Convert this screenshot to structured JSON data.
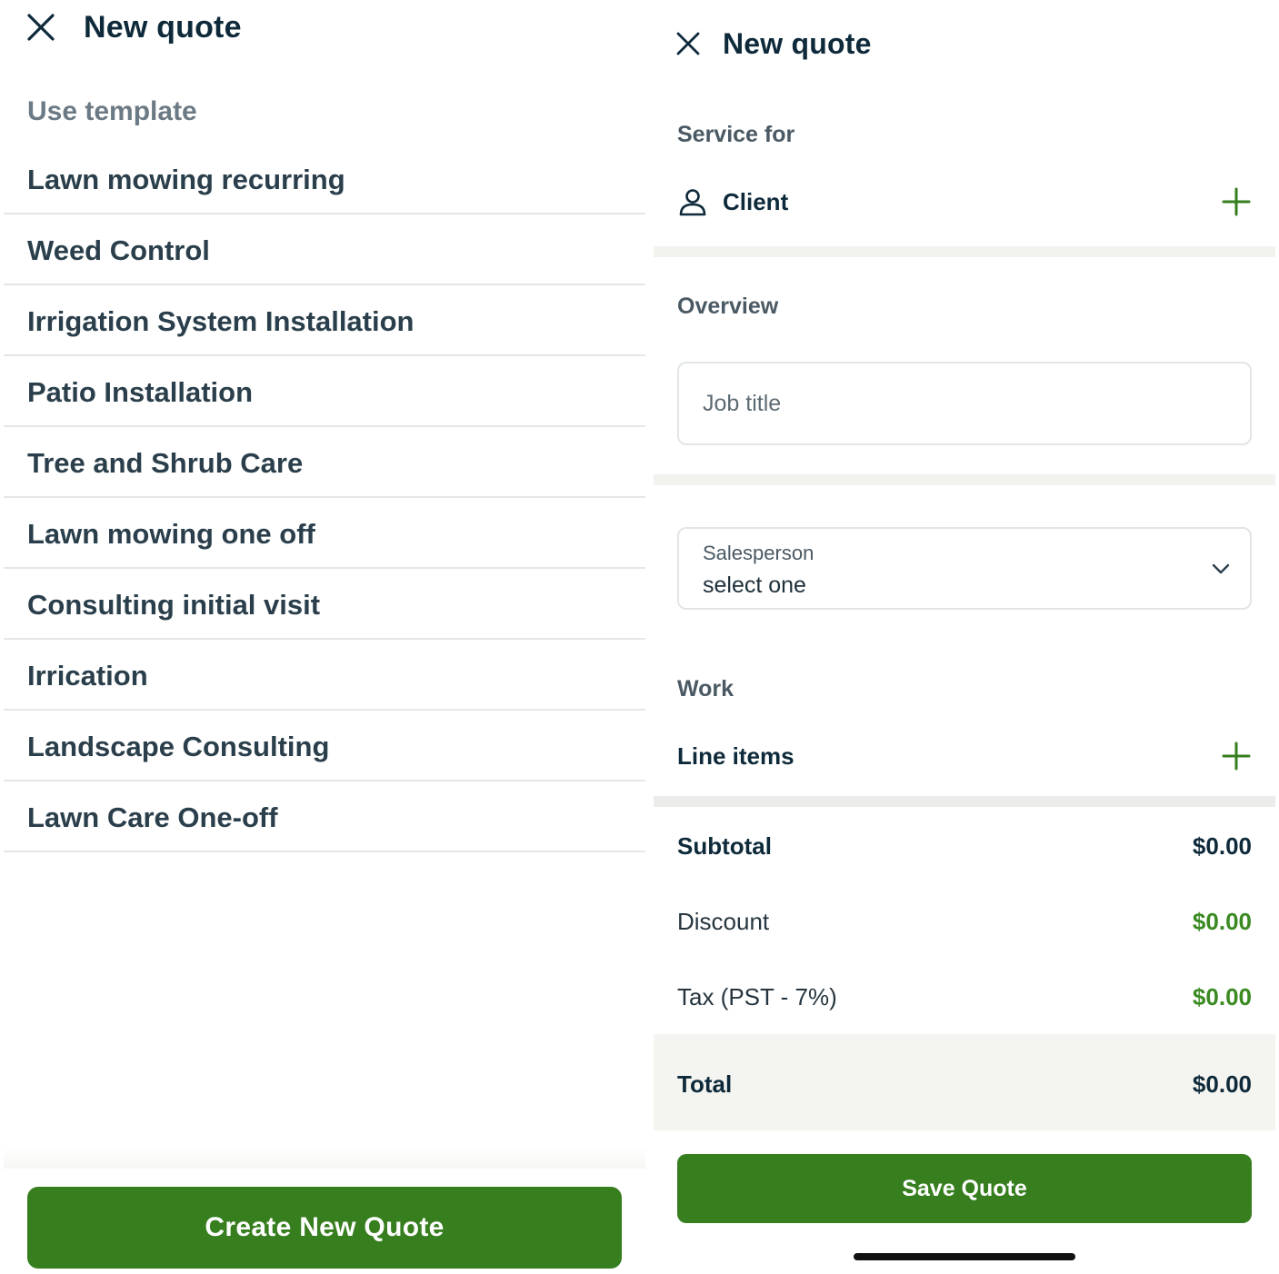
{
  "left": {
    "title": "New quote",
    "template_heading": "Use template",
    "templates": [
      "Lawn mowing recurring",
      "Weed Control",
      "Irrigation System Installation",
      "Patio Installation",
      "Tree and Shrub Care",
      "Lawn mowing one off",
      "Consulting initial visit",
      "Irrication",
      "Landscape Consulting",
      "Lawn Care One-off"
    ],
    "create_button": "Create New Quote"
  },
  "right": {
    "title": "New quote",
    "service_for_label": "Service for",
    "client_label": "Client",
    "overview_label": "Overview",
    "job_title_placeholder": "Job title",
    "salesperson_label": "Salesperson",
    "salesperson_value": "select one",
    "work_label": "Work",
    "line_items_label": "Line items",
    "subtotal_label": "Subtotal",
    "subtotal_value": "$0.00",
    "discount_label": "Discount",
    "discount_value": "$0.00",
    "tax_label": "Tax (PST - 7%)",
    "tax_value": "$0.00",
    "total_label": "Total",
    "total_value": "$0.00",
    "save_button": "Save Quote"
  },
  "colors": {
    "brand_green": "#367e1e",
    "amount_green": "#3a8a22",
    "text_dark": "#0e2a3a"
  },
  "icons": {
    "close": "close-icon",
    "person": "person-icon",
    "plus": "plus-icon",
    "chevron": "chevron-down-icon"
  }
}
